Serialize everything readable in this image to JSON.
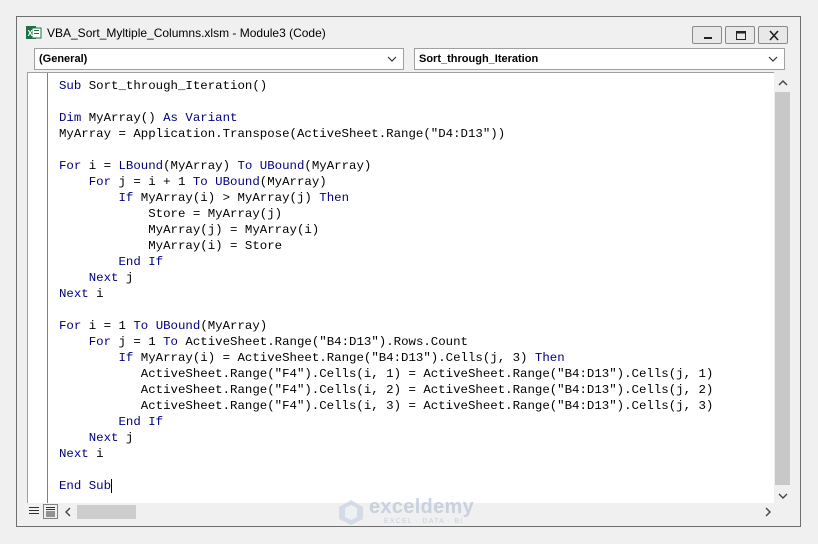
{
  "window": {
    "title": "VBA_Sort_Myltiple_Columns.xlsm - Module3 (Code)"
  },
  "combos": {
    "object": "(General)",
    "procedure": "Sort_through_Iteration"
  },
  "code_lines": [
    [
      {
        "t": "Sub",
        "k": true
      },
      {
        "t": " Sort_through_Iteration()"
      }
    ],
    [
      {
        "t": ""
      }
    ],
    [
      {
        "t": "Dim",
        "k": true
      },
      {
        "t": " MyArray() "
      },
      {
        "t": "As",
        "k": true
      },
      {
        "t": " "
      },
      {
        "t": "Variant",
        "k": true
      }
    ],
    [
      {
        "t": "MyArray = Application.Transpose(ActiveSheet.Range(\"D4:D13\"))"
      }
    ],
    [
      {
        "t": ""
      }
    ],
    [
      {
        "t": "For",
        "k": true
      },
      {
        "t": " i = "
      },
      {
        "t": "LBound",
        "k": true
      },
      {
        "t": "(MyArray) "
      },
      {
        "t": "To",
        "k": true
      },
      {
        "t": " "
      },
      {
        "t": "UBound",
        "k": true
      },
      {
        "t": "(MyArray)"
      }
    ],
    [
      {
        "t": "    "
      },
      {
        "t": "For",
        "k": true
      },
      {
        "t": " j = i + 1 "
      },
      {
        "t": "To",
        "k": true
      },
      {
        "t": " "
      },
      {
        "t": "UBound",
        "k": true
      },
      {
        "t": "(MyArray)"
      }
    ],
    [
      {
        "t": "        "
      },
      {
        "t": "If",
        "k": true
      },
      {
        "t": " MyArray(i) > MyArray(j) "
      },
      {
        "t": "Then",
        "k": true
      }
    ],
    [
      {
        "t": "            Store = MyArray(j)"
      }
    ],
    [
      {
        "t": "            MyArray(j) = MyArray(i)"
      }
    ],
    [
      {
        "t": "            MyArray(i) = Store"
      }
    ],
    [
      {
        "t": "        "
      },
      {
        "t": "End If",
        "k": true
      }
    ],
    [
      {
        "t": "    "
      },
      {
        "t": "Next",
        "k": true
      },
      {
        "t": " j"
      }
    ],
    [
      {
        "t": "Next",
        "k": true
      },
      {
        "t": " i"
      }
    ],
    [
      {
        "t": ""
      }
    ],
    [
      {
        "t": "For",
        "k": true
      },
      {
        "t": " i = 1 "
      },
      {
        "t": "To",
        "k": true
      },
      {
        "t": " "
      },
      {
        "t": "UBound",
        "k": true
      },
      {
        "t": "(MyArray)"
      }
    ],
    [
      {
        "t": "    "
      },
      {
        "t": "For",
        "k": true
      },
      {
        "t": " j = 1 "
      },
      {
        "t": "To",
        "k": true
      },
      {
        "t": " ActiveSheet.Range(\"B4:D13\").Rows.Count"
      }
    ],
    [
      {
        "t": "        "
      },
      {
        "t": "If",
        "k": true
      },
      {
        "t": " MyArray(i) = ActiveSheet.Range(\"B4:D13\").Cells(j, 3) "
      },
      {
        "t": "Then",
        "k": true
      }
    ],
    [
      {
        "t": "           ActiveSheet.Range(\"F4\").Cells(i, 1) = ActiveSheet.Range(\"B4:D13\").Cells(j, 1)"
      }
    ],
    [
      {
        "t": "           ActiveSheet.Range(\"F4\").Cells(i, 2) = ActiveSheet.Range(\"B4:D13\").Cells(j, 2)"
      }
    ],
    [
      {
        "t": "           ActiveSheet.Range(\"F4\").Cells(i, 3) = ActiveSheet.Range(\"B4:D13\").Cells(j, 3)"
      }
    ],
    [
      {
        "t": "        "
      },
      {
        "t": "End If",
        "k": true
      }
    ],
    [
      {
        "t": "    "
      },
      {
        "t": "Next",
        "k": true
      },
      {
        "t": " j"
      }
    ],
    [
      {
        "t": "Next",
        "k": true
      },
      {
        "t": " i"
      }
    ],
    [
      {
        "t": ""
      }
    ],
    [
      {
        "t": "End Sub",
        "k": true
      }
    ]
  ],
  "caret_line": 25,
  "watermark": {
    "name": "exceldemy",
    "tagline": "EXCEL · DATA · BI"
  },
  "colors": {
    "keyword": "#00007f",
    "text": "#000000"
  },
  "icons": {
    "app": "excel-vba-icon",
    "minimize": "minimize-icon",
    "maximize": "maximize-icon",
    "close": "close-icon",
    "dropdown": "chevron-down-icon",
    "scroll_up": "arrow-up-icon",
    "scroll_down": "arrow-down-icon",
    "scroll_left": "arrow-left-icon",
    "scroll_right": "arrow-right-icon",
    "procedure_view": "procedure-view-icon",
    "full_module_view": "full-module-view-icon"
  }
}
